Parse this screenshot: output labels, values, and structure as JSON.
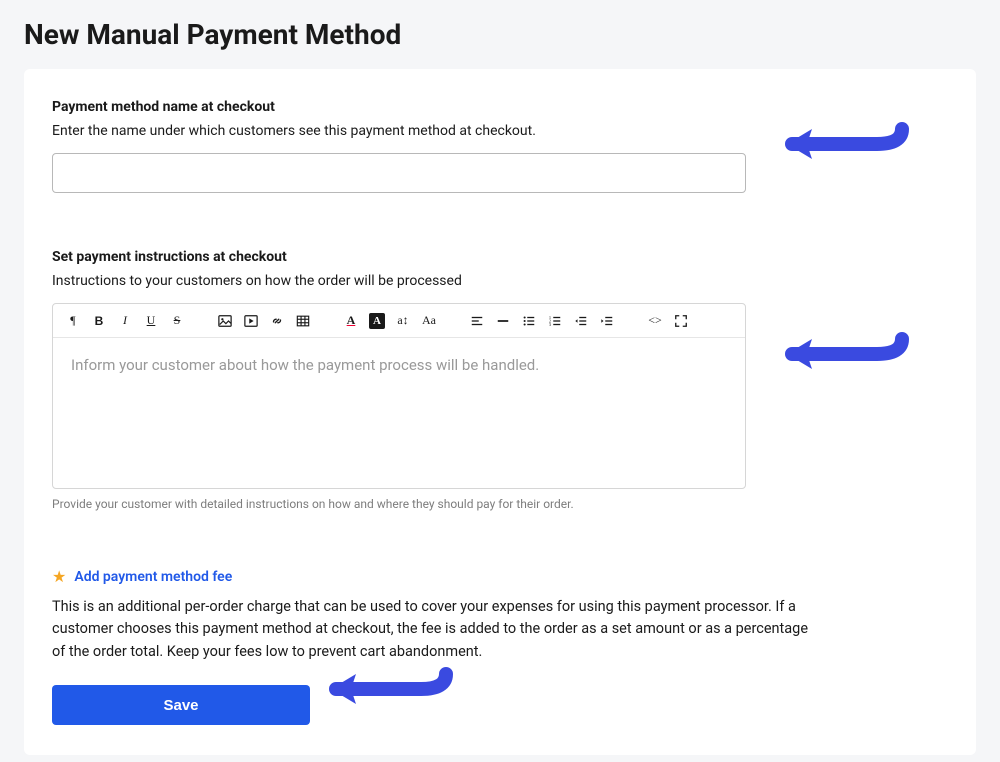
{
  "page": {
    "title": "New Manual Payment Method"
  },
  "section_name": {
    "label": "Payment method name at checkout",
    "help": "Enter the name under which customers see this payment method at checkout.",
    "value": ""
  },
  "section_instructions": {
    "label": "Set payment instructions at checkout",
    "help": "Instructions to your customers on how the order will be processed",
    "placeholder": "Inform your customer about how the payment process will be handled.",
    "footnote": "Provide your customer with detailed instructions on how and where they should pay for their order."
  },
  "toolbar": {
    "paragraph": "¶",
    "bold": "B",
    "italic": "I",
    "underline": "U",
    "strike": "S",
    "text_color": "A",
    "bg_color": "A",
    "line_height": "a↕",
    "text_size": "Aa",
    "code": "<>"
  },
  "section_fee": {
    "link_label": "Add payment method fee",
    "description": "This is an additional per-order charge that can be used to cover your expenses for using this payment processor. If a customer chooses this payment method at checkout, the fee is added to the order as a set amount or as a percentage of the order total. Keep your fees low to prevent cart abandonment."
  },
  "buttons": {
    "save": "Save"
  }
}
